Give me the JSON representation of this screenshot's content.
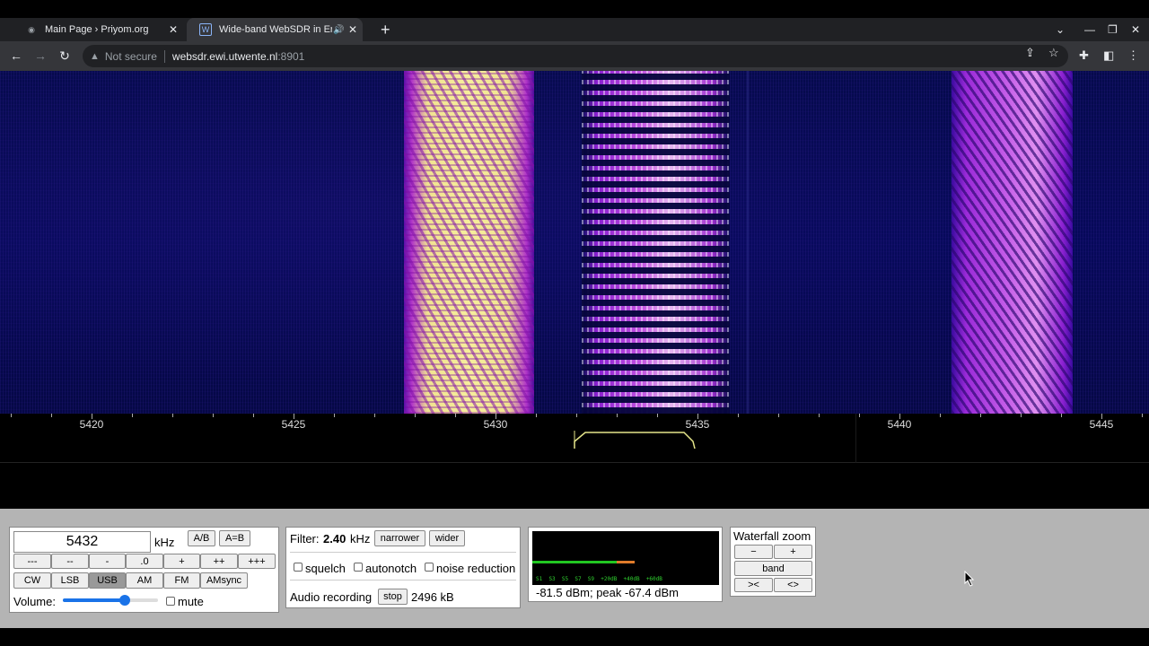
{
  "browser": {
    "tabs": [
      {
        "title": "Main Page › Priyom.org",
        "active": false
      },
      {
        "title": "Wide-band WebSDR in Ensch",
        "active": true
      }
    ],
    "new_tab": "+",
    "address": {
      "not_secure": "Not secure",
      "host": "websdr.ewi.utwente.nl",
      "port": ":8901"
    }
  },
  "scale": {
    "labels": [
      {
        "text": "5420",
        "khz": 5420
      },
      {
        "text": "5425",
        "khz": 5425
      },
      {
        "text": "5430",
        "khz": 5430
      },
      {
        "text": "5435",
        "khz": 5435
      },
      {
        "text": "5440",
        "khz": 5440
      },
      {
        "text": "5445",
        "khz": 5445
      }
    ]
  },
  "tuning": {
    "frequency": "5432",
    "unit": "kHz",
    "ab": "A/B",
    "a_eq_b": "A=B",
    "step_buttons": [
      "---",
      "--",
      "-",
      ".0",
      "+",
      "++",
      "+++"
    ],
    "modes": [
      "CW",
      "LSB",
      "USB",
      "AM",
      "FM",
      "AMsync"
    ],
    "selected_mode": "USB",
    "volume_label": "Volume:",
    "volume_level": 0.65,
    "mute_label": "mute"
  },
  "filter": {
    "label": "Filter:",
    "value": "2.40",
    "unit": "kHz",
    "narrower": "narrower",
    "wider": "wider",
    "squelch": "squelch",
    "autonotch": "autonotch",
    "noise_reduction": "noise reduction",
    "recording_label": "Audio recording",
    "stop": "stop",
    "recording_size": "2496 kB"
  },
  "smeter": {
    "scale_text": "S1  S3  S5  S7  S9  +20dB  +40dB  +60dB",
    "reading": "-81.5 dBm; peak  -67.4 dBm",
    "level": 0.45,
    "peak_level": 0.46,
    "colors": {
      "level": "#22c722",
      "peak": "#e07b2a"
    }
  },
  "zoom": {
    "title": "Waterfall zoom",
    "minus": "−",
    "plus": "+",
    "band": "band",
    "narrow": "><",
    "wide": "<>"
  }
}
